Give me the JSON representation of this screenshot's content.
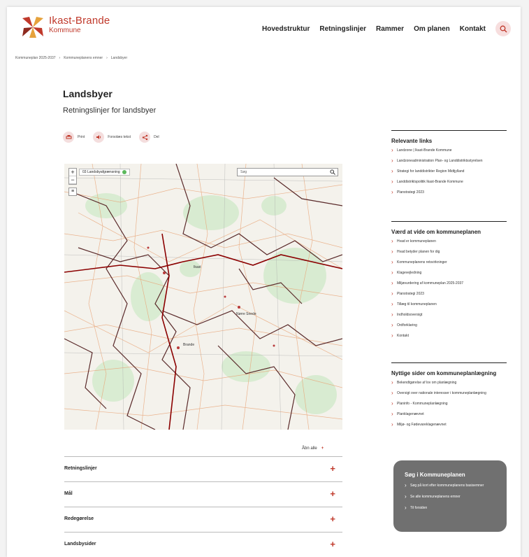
{
  "header": {
    "logo_name": "Ikast-Brande",
    "logo_sub": "Kommune",
    "nav": [
      "Hovedstruktur",
      "Retningslinjer",
      "Rammer",
      "Om planen",
      "Kontakt"
    ],
    "search_icon": "search-icon"
  },
  "breadcrumb": [
    "Kommuneplan 2025-2037",
    "›",
    "Kommuneplanens emner",
    "›",
    "Landsbyer"
  ],
  "main": {
    "title": "Landsbyer",
    "subtitle": "Retningslinjer for landsbyer",
    "tools": [
      {
        "icon": "print-icon",
        "label": "Print"
      },
      {
        "icon": "read-aloud-icon",
        "label": "Forsolæs tekst"
      },
      {
        "icon": "share-icon",
        "label": "Del"
      }
    ],
    "map": {
      "zoom_in": "+",
      "zoom_out": "−",
      "layer_label": "03 Landsbyafgrænsning",
      "search_placeholder": "Søg",
      "towns": [
        "Ikast",
        "Brande",
        "Nørre Snede"
      ]
    },
    "expand_all": "Åbn alle",
    "accordion": [
      "Retningslinjer",
      "Mål",
      "Redegørelse",
      "Landsbysider"
    ]
  },
  "sidebar": {
    "sections": [
      {
        "title": "Relevante links",
        "items": [
          "Landzone | Ikast-Brande Kommune",
          "Landzoneadministration Plan- og Landdistriktsstyrelsen",
          "Strategi for landdistrikter Region Midtjylland",
          "Landdistriktspolitik Ikast-Brande Kommune",
          "Planstrategi 2023"
        ]
      },
      {
        "title": "Værd at vide om kommuneplanen",
        "items": [
          "Hvad er kommuneplanen",
          "Hvad betyder planen for dig",
          "Kommuneplanens retsvirkninger",
          "Klagevejledning",
          "Miljøvurdering af kommuneplan 2025-2037",
          "Planstrategi 2023",
          "Tillæg til kommuneplanen",
          "Indholdsoversigt",
          "Ordforklaring",
          "Kontakt"
        ]
      },
      {
        "title": "Nyttige sider om kommuneplanlægning",
        "items": [
          "Bekendtgørelse af lov om planlægning",
          "Oversigt over nationale interesser i kommuneplanlægning",
          "Planinfo - Kommuneplanlægning",
          "Planklagenævnet",
          "Miljø- og Fødevareklagenævnet"
        ]
      }
    ],
    "search_box": {
      "title": "Søg i Kommuneplanen",
      "items": [
        "Søg på kort efter kommuneplanens basisemner",
        "Se alle kommuneplanens emner",
        "Til forsiden"
      ]
    }
  },
  "colors": {
    "accent": "#c0392b",
    "search_box_bg": "#707070"
  }
}
